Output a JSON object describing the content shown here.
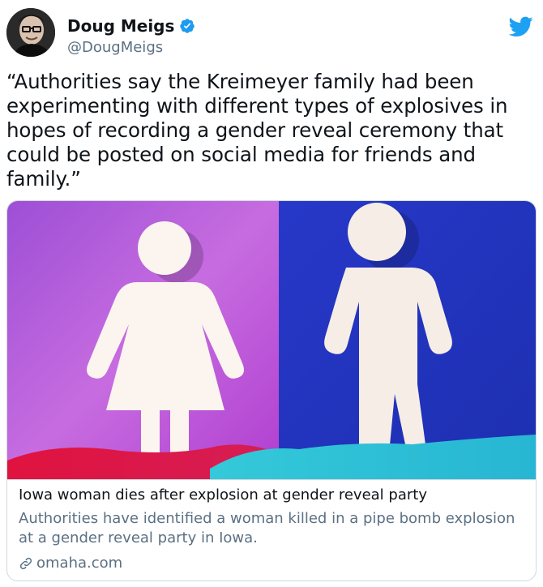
{
  "author": {
    "name": "Doug Meigs",
    "handle": "@DougMeigs",
    "verified": true
  },
  "tweet": {
    "text": "“Authorities say the Kreimeyer family had been experimenting with different types of explosives in hopes of recording a gender reveal ceremony that could be posted on social media for friends and family.”"
  },
  "card": {
    "image_description_icon": "gender-figures-image",
    "title": "Iowa woman dies after explosion at gender reveal party",
    "description": "Authorities have identified a woman killed in a pipe bomb explosion at a gender reveal party in Iowa.",
    "domain": "omaha.com"
  },
  "colors": {
    "twitter_blue": "#1da1f2",
    "verified_blue": "#1d9bf0",
    "secondary_text": "#5b7083",
    "pink_bg": "#c06ad8",
    "blue_bg": "#2a3fc4"
  },
  "icons": [
    "verified-badge-icon",
    "twitter-bird-icon",
    "link-icon"
  ]
}
